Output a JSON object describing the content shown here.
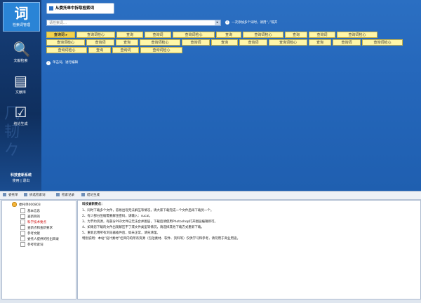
{
  "sidebar": {
    "items": [
      {
        "label": "检索词管理",
        "icon": "词"
      },
      {
        "label": "文献检索",
        "icon": "🔍"
      },
      {
        "label": "文献库",
        "icon": "▤"
      },
      {
        "label": "结论生成",
        "icon": "☑"
      }
    ],
    "footer_title": "科技查新系统",
    "footer_links": "使用 | 退出"
  },
  "header": {
    "title": "从委托单中拆取检索词"
  },
  "search": {
    "placeholder": "请检索词…",
    "button": "▸"
  },
  "hint": "一次添加多个词时，请用“，”隔开",
  "keywords": [
    "查询词 ▸",
    "查询词检心",
    "查询",
    "查询词",
    "查询词检心",
    "查询",
    "查询词检心",
    "查询",
    "查询词",
    "查询词检心",
    "查询词检心",
    "查询词",
    "查询",
    "查询词检心",
    "查询词",
    "查询",
    "查询词",
    "查询词检心",
    "查询",
    "查询词",
    "查询词检心",
    "查询词检心",
    "查询词检心",
    "查询",
    "查询词",
    "查询词检心"
  ],
  "help": "单击词，进行编辑",
  "tabs": [
    "委托单",
    "拆选检索词",
    "检索记录",
    "结论生成"
  ],
  "tree": {
    "root": "委托单000803",
    "nodes": [
      "基本信息",
      "查新目的",
      "科学技术要点",
      "查新点和查新要求",
      "参考文献",
      "委托人提供的检出目录",
      "参考检索词"
    ]
  },
  "content": {
    "lines": [
      "科技查新要点：",
      "1、同时下载多个文件，容易出现无法解压等情况，请大家下载完成一个文件后再下载另一个。",
      "2、有少部分压缩需要解压密码，请输入：sucai。",
      "3、为节约资源，有部分PSD文件已无法合并图层，下载后请使用Photoshop打开图层编辑即可。",
      "4、如果您下载的文件出现解压不了或文件类型等情况，请选择其他下载方式重新下载。",
      "5、重新启用所有浏览器插件后，如未正常，请先清理。",
      "特别说明：本站“设计素材”栏目内的所有资源（包括素材、软件、资料等）仅供学习和参考，请勿用于商业用途。"
    ]
  },
  "colors": {
    "accent": "#1e5fb0",
    "keyword": "#fff6a8"
  }
}
